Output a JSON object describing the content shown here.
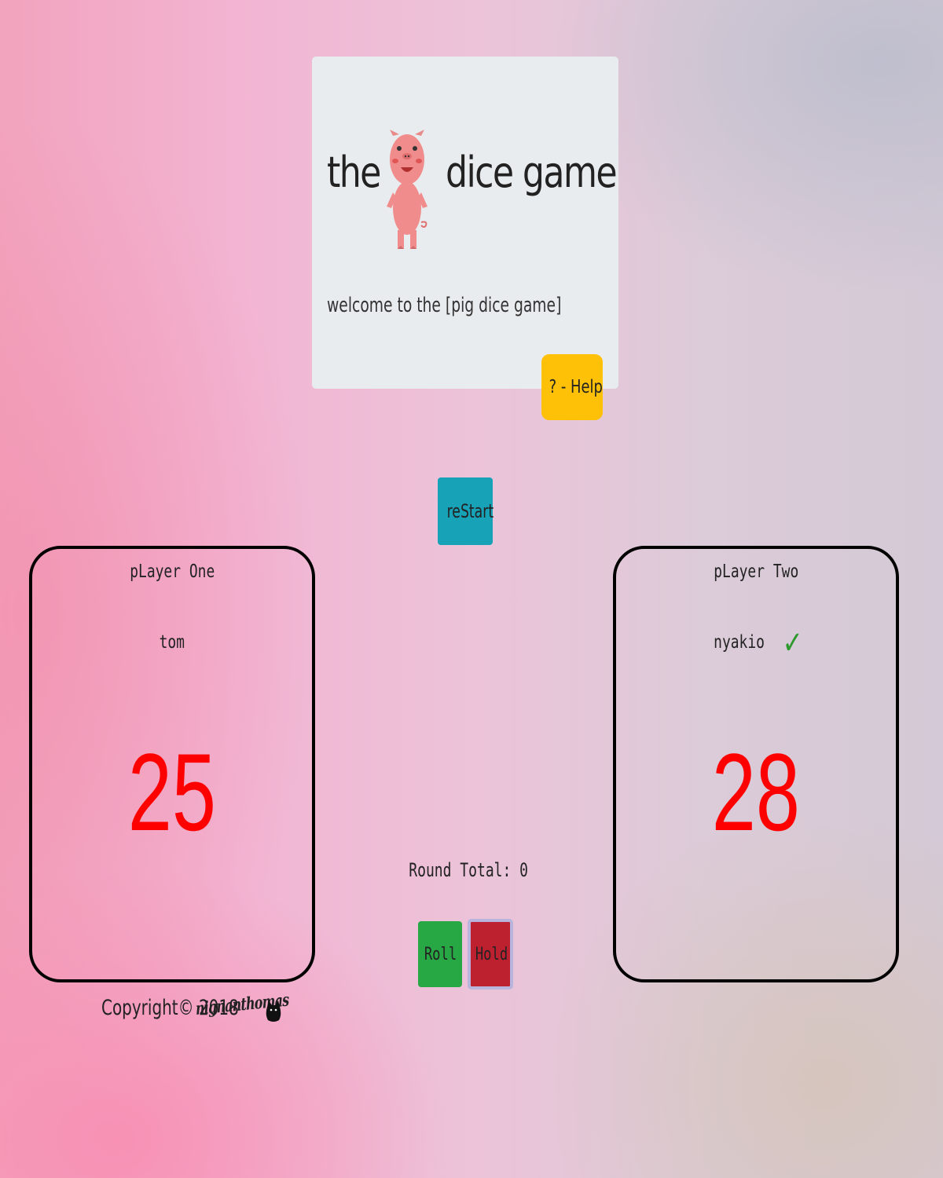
{
  "header": {
    "title_left": "the",
    "title_right": "dice game",
    "logo_icon": "pig-icon",
    "welcome_text": "welcome to the [pig dice game]",
    "help_label": "? - Help"
  },
  "controls": {
    "restart_label": "reStart",
    "round_total": "Round Total: 0",
    "roll_label": "Roll",
    "hold_label": "Hold"
  },
  "players": [
    {
      "heading": "pLayer One",
      "name": "tom",
      "score": "25",
      "active": false
    },
    {
      "heading": "pLayer Two",
      "name": "nyakio",
      "score": "28",
      "active": true,
      "active_icon": "checkmark-icon",
      "active_mark": "✓"
    }
  ],
  "footer": {
    "copyright": "Copyright© 2018",
    "signature": "nignanthomas",
    "icon": "cat-icon"
  },
  "colors": {
    "help": "#ffc107",
    "restart": "#17a2b8",
    "roll": "#28a745",
    "hold": "#bd2130",
    "score": "#ff0000",
    "card": "#e9ecef"
  }
}
